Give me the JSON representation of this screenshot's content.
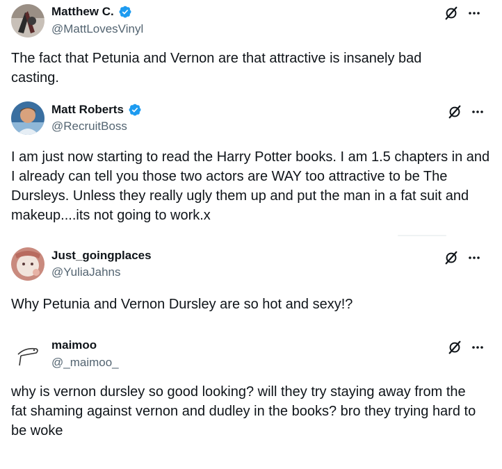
{
  "posts": [
    {
      "display_name": "Matthew C.",
      "handle": "@MattLovesVinyl",
      "verified": true,
      "text": "The fact that Petunia and Vernon are that attractive is insanely bad casting.",
      "avatar_icon": "avatar-vinyl-icon"
    },
    {
      "display_name": "Matt Roberts",
      "handle": "@RecruitBoss",
      "verified": true,
      "text": "I am just now starting to read the Harry Potter books. I am 1.5 chapters in and I already can tell you those two actors are WAY too attractive to be The Dursleys. Unless they really ugly them up and put the man in a fat suit  and makeup....its not going to work.x",
      "avatar_icon": "avatar-photo-icon"
    },
    {
      "display_name": "Just_goingplaces",
      "handle": "@YuliaJahns",
      "verified": false,
      "text": "Why Petunia and Vernon Dursley are so hot and sexy!?",
      "avatar_icon": "avatar-drawing-icon"
    },
    {
      "display_name": "maimoo",
      "handle": "@_maimoo_",
      "verified": false,
      "text": "why is vernon dursley so good looking? will they try staying away from the fat shaming against vernon and dudley in the books? bro they trying hard to be woke",
      "avatar_icon": "avatar-sketch-icon"
    }
  ],
  "colors": {
    "text": "#0f1419",
    "secondary": "#536471",
    "verified": "#1d9bf0",
    "background": "#ffffff"
  }
}
